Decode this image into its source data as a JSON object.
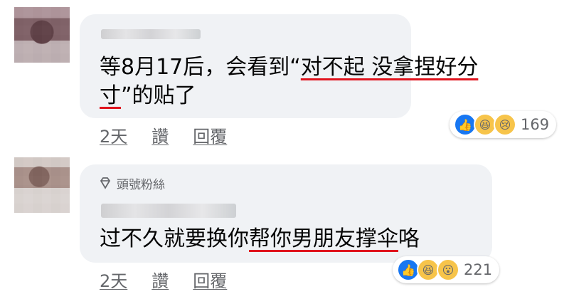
{
  "comments": [
    {
      "text_line1_a": "等8月17后，会看到“",
      "text_line1_b": "对不起 没拿捏好分",
      "text_line2_a": "寸",
      "text_line2_b": "”的贴了",
      "meta": {
        "time": "2天",
        "like": "讚",
        "reply": "回覆"
      },
      "reactions": {
        "icons": [
          "like-icon",
          "haha-icon",
          "sad-icon"
        ],
        "count": "169"
      }
    },
    {
      "badge": "頭號粉絲",
      "text_a": "过不久就要换你",
      "text_b": "帮你男朋友撑伞",
      "text_c": "咯",
      "meta": {
        "time": "2天",
        "like": "讚",
        "reply": "回覆"
      },
      "reactions": {
        "icons": [
          "like-icon",
          "haha-icon",
          "wow-icon"
        ],
        "count": "221"
      }
    }
  ]
}
